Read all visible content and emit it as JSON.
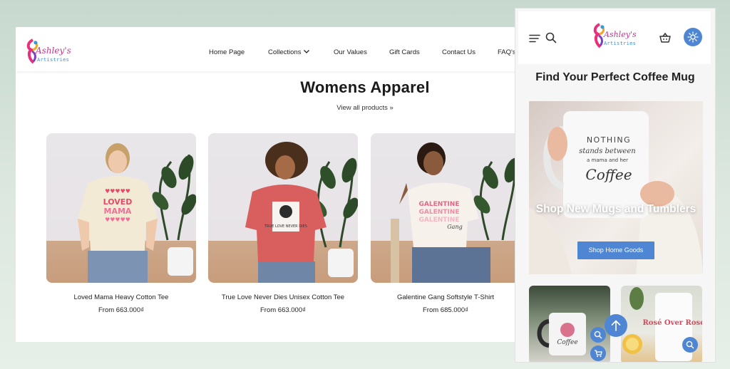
{
  "desktop": {
    "logo": {
      "script": "Ashley's",
      "sub": "Artistries"
    },
    "nav": [
      {
        "label": "Home Page"
      },
      {
        "label": "Collections",
        "has_dropdown": true
      },
      {
        "label": "Our Values"
      },
      {
        "label": "Gift Cards"
      },
      {
        "label": "Contact Us"
      },
      {
        "label": "FAQ's"
      }
    ],
    "section": {
      "title": "Womens Apparel",
      "view_all": "View all products »"
    },
    "products": [
      {
        "title": "Loved Mama Heavy Cotton Tee",
        "price": "From 663.000₫",
        "shirt_color": "#f2ead4",
        "print_text": "LOVED MAMA"
      },
      {
        "title": "True Love Never Dies Unisex Cotton Tee",
        "price": "From 663.000₫",
        "shirt_color": "#d95f5f",
        "print_text": "TRUE LOVE NEVER DIES"
      },
      {
        "title": "Galentine Gang Softstyle T-Shirt",
        "price": "From 685.000₫",
        "shirt_color": "#f6f1ea",
        "print_text": "GALENTINE GALENTINE GALENTINE Gang"
      }
    ]
  },
  "mobile": {
    "logo": {
      "script": "Ashley's",
      "sub": "Artistries"
    },
    "icons": [
      "menu-icon",
      "search-icon",
      "basket-icon",
      "theme-toggle-icon"
    ],
    "title": "Find Your Perfect Coffee Mug",
    "hero": {
      "mug_text_1": "NOTHING",
      "mug_text_2": "stands between",
      "mug_text_3": "a mama and her",
      "mug_text_4": "Coffee",
      "heading": "Shop New Mugs and Tumblers",
      "button": "Shop Home Goods"
    },
    "thumbs": [
      {
        "mug_text": "Coffee"
      },
      {
        "mug_text": "Rosé Over Rose"
      }
    ]
  },
  "colors": {
    "accent": "#4f86d4",
    "logo_pink": "#c0398d",
    "logo_blue": "#3b8fd6",
    "page_bg": "#d4e3d9"
  }
}
